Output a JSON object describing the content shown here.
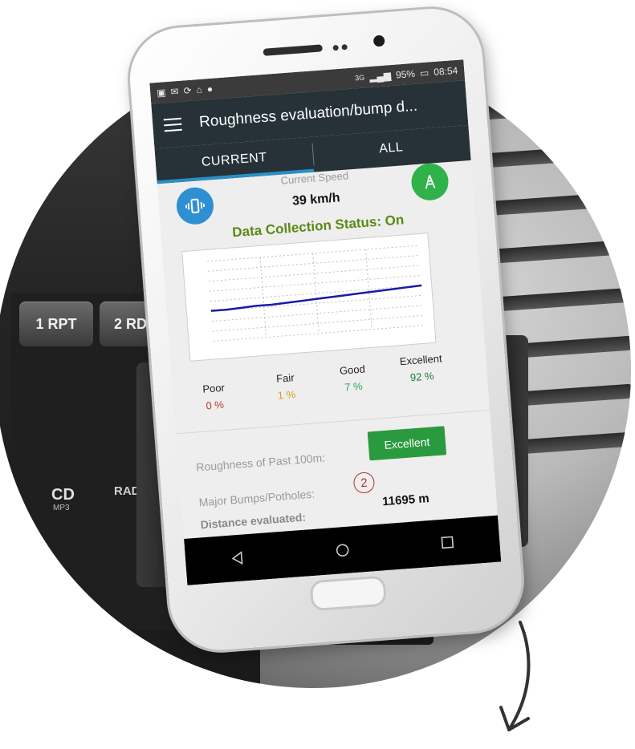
{
  "status_bar": {
    "network": "3G",
    "battery": "95%",
    "time": "08:54",
    "icons": [
      "image-icon",
      "mail-icon",
      "sync-icon",
      "lock-icon",
      "location-icon",
      "signal-icon",
      "battery-icon"
    ]
  },
  "appbar": {
    "title": "Roughness evaluation/bump d...",
    "menu_icon": "menu-icon"
  },
  "tabs": [
    {
      "label": "CURRENT",
      "selected": true
    },
    {
      "label": "ALL",
      "selected": false
    }
  ],
  "speed": {
    "label": "Current Speed",
    "value": "39 km/h"
  },
  "buttons": {
    "vibration_icon": "vibration-icon",
    "gps_icon": "gps-tower-icon"
  },
  "data_collection": {
    "status": "Data Collection Status: On",
    "color": "#5a8a14"
  },
  "chart_data": {
    "type": "line",
    "title": "",
    "xlabel": "",
    "ylabel": "",
    "grid": true,
    "ylim": [
      0,
      1
    ],
    "series": [
      {
        "values": [
          0.38,
          0.38,
          0.39,
          0.4,
          0.4,
          0.41,
          0.42,
          0.43,
          0.44,
          0.45,
          0.46,
          0.47,
          0.48,
          0.49,
          0.5
        ],
        "color": "#1a1aa8"
      }
    ]
  },
  "quality_legend": [
    {
      "label": "Poor",
      "value": "0 %",
      "color": "#c0392b"
    },
    {
      "label": "Fair",
      "value": "1 %",
      "color": "#d4a017"
    },
    {
      "label": "Good",
      "value": "7 %",
      "color": "#2fa84f"
    },
    {
      "label": "Excellent",
      "value": "92 %",
      "color": "#1e7a34"
    }
  ],
  "roughness": {
    "label": "Roughness of Past 100m:",
    "value": "Excellent",
    "color": "#2a9a3e"
  },
  "bumps": {
    "label": "Major Bumps/Potholes:",
    "count": "2"
  },
  "distance": {
    "label": "Distance evaluated:",
    "value": "11695 m"
  },
  "navbar": {
    "back_icon": "back-icon",
    "home_icon": "home-icon",
    "recents_icon": "recents-icon"
  },
  "dashboard": {
    "radio_buttons": [
      "1 RPT",
      "2 RDM"
    ],
    "cd_label": "CD",
    "cd_sub": "MP3",
    "radio_label": "RADIO"
  }
}
